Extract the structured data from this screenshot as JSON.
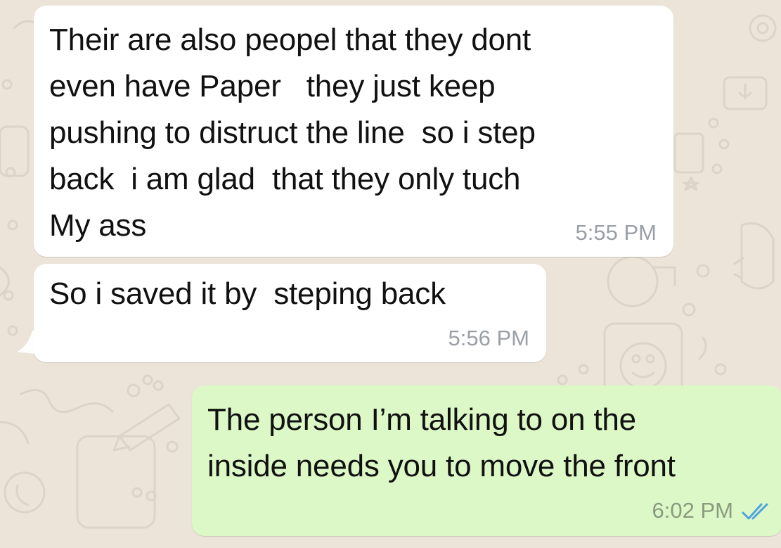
{
  "chat": {
    "messages": [
      {
        "direction": "incoming",
        "lines": [
          "Their are also peopel that they dont",
          "even have Paper   they just keep",
          "pushing to distruct the line  so i step",
          "back  i am glad  that they only tuch",
          "My ass"
        ],
        "time": "5:55 PM"
      },
      {
        "direction": "incoming",
        "lines": [
          "So i saved it by  steping back"
        ],
        "time": "5:56 PM"
      },
      {
        "direction": "outgoing",
        "lines": [
          "The person I’m talking to on the",
          "inside needs you to move the front"
        ],
        "time": "6:02 PM",
        "status_icon": "double-check-read-icon"
      }
    ]
  },
  "colors": {
    "wallpaper": "#ECE4D9",
    "incoming_bubble": "#FFFFFF",
    "outgoing_bubble": "#DCF8C6",
    "read_ticks": "#4FA3E0"
  }
}
